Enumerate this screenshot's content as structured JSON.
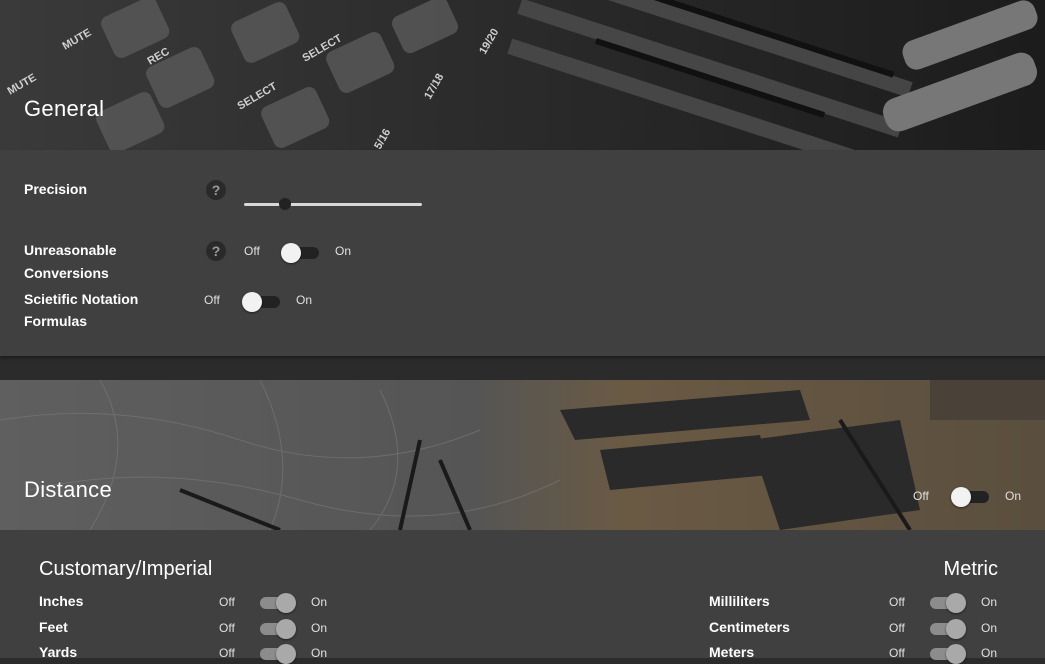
{
  "general": {
    "title": "General",
    "precision": {
      "label": "Precision",
      "help": "?",
      "value_fraction": 0.23
    },
    "unreasonable": {
      "label_line1": "Unreasonable",
      "label_line2": "Conversions",
      "help": "?",
      "off": "Off",
      "on": "On",
      "state": false
    },
    "scientific": {
      "label_line1": "Scietific Notation",
      "label_line2": "Formulas",
      "off": "Off",
      "on": "On",
      "state": false
    }
  },
  "distance": {
    "title": "Distance",
    "off": "Off",
    "on": "On",
    "state": false,
    "customary": {
      "heading": "Customary/Imperial",
      "units": [
        {
          "label": "Inches",
          "off": "Off",
          "on": "On",
          "state": true
        },
        {
          "label": "Feet",
          "off": "Off",
          "on": "On",
          "state": true
        },
        {
          "label": "Yards",
          "off": "Off",
          "on": "On",
          "state": true
        }
      ]
    },
    "metric": {
      "heading": "Metric",
      "units": [
        {
          "label": "Milliliters",
          "off": "Off",
          "on": "On",
          "state": true
        },
        {
          "label": "Centimeters",
          "off": "Off",
          "on": "On",
          "state": true
        },
        {
          "label": "Meters",
          "off": "Off",
          "on": "On",
          "state": true
        }
      ]
    }
  }
}
